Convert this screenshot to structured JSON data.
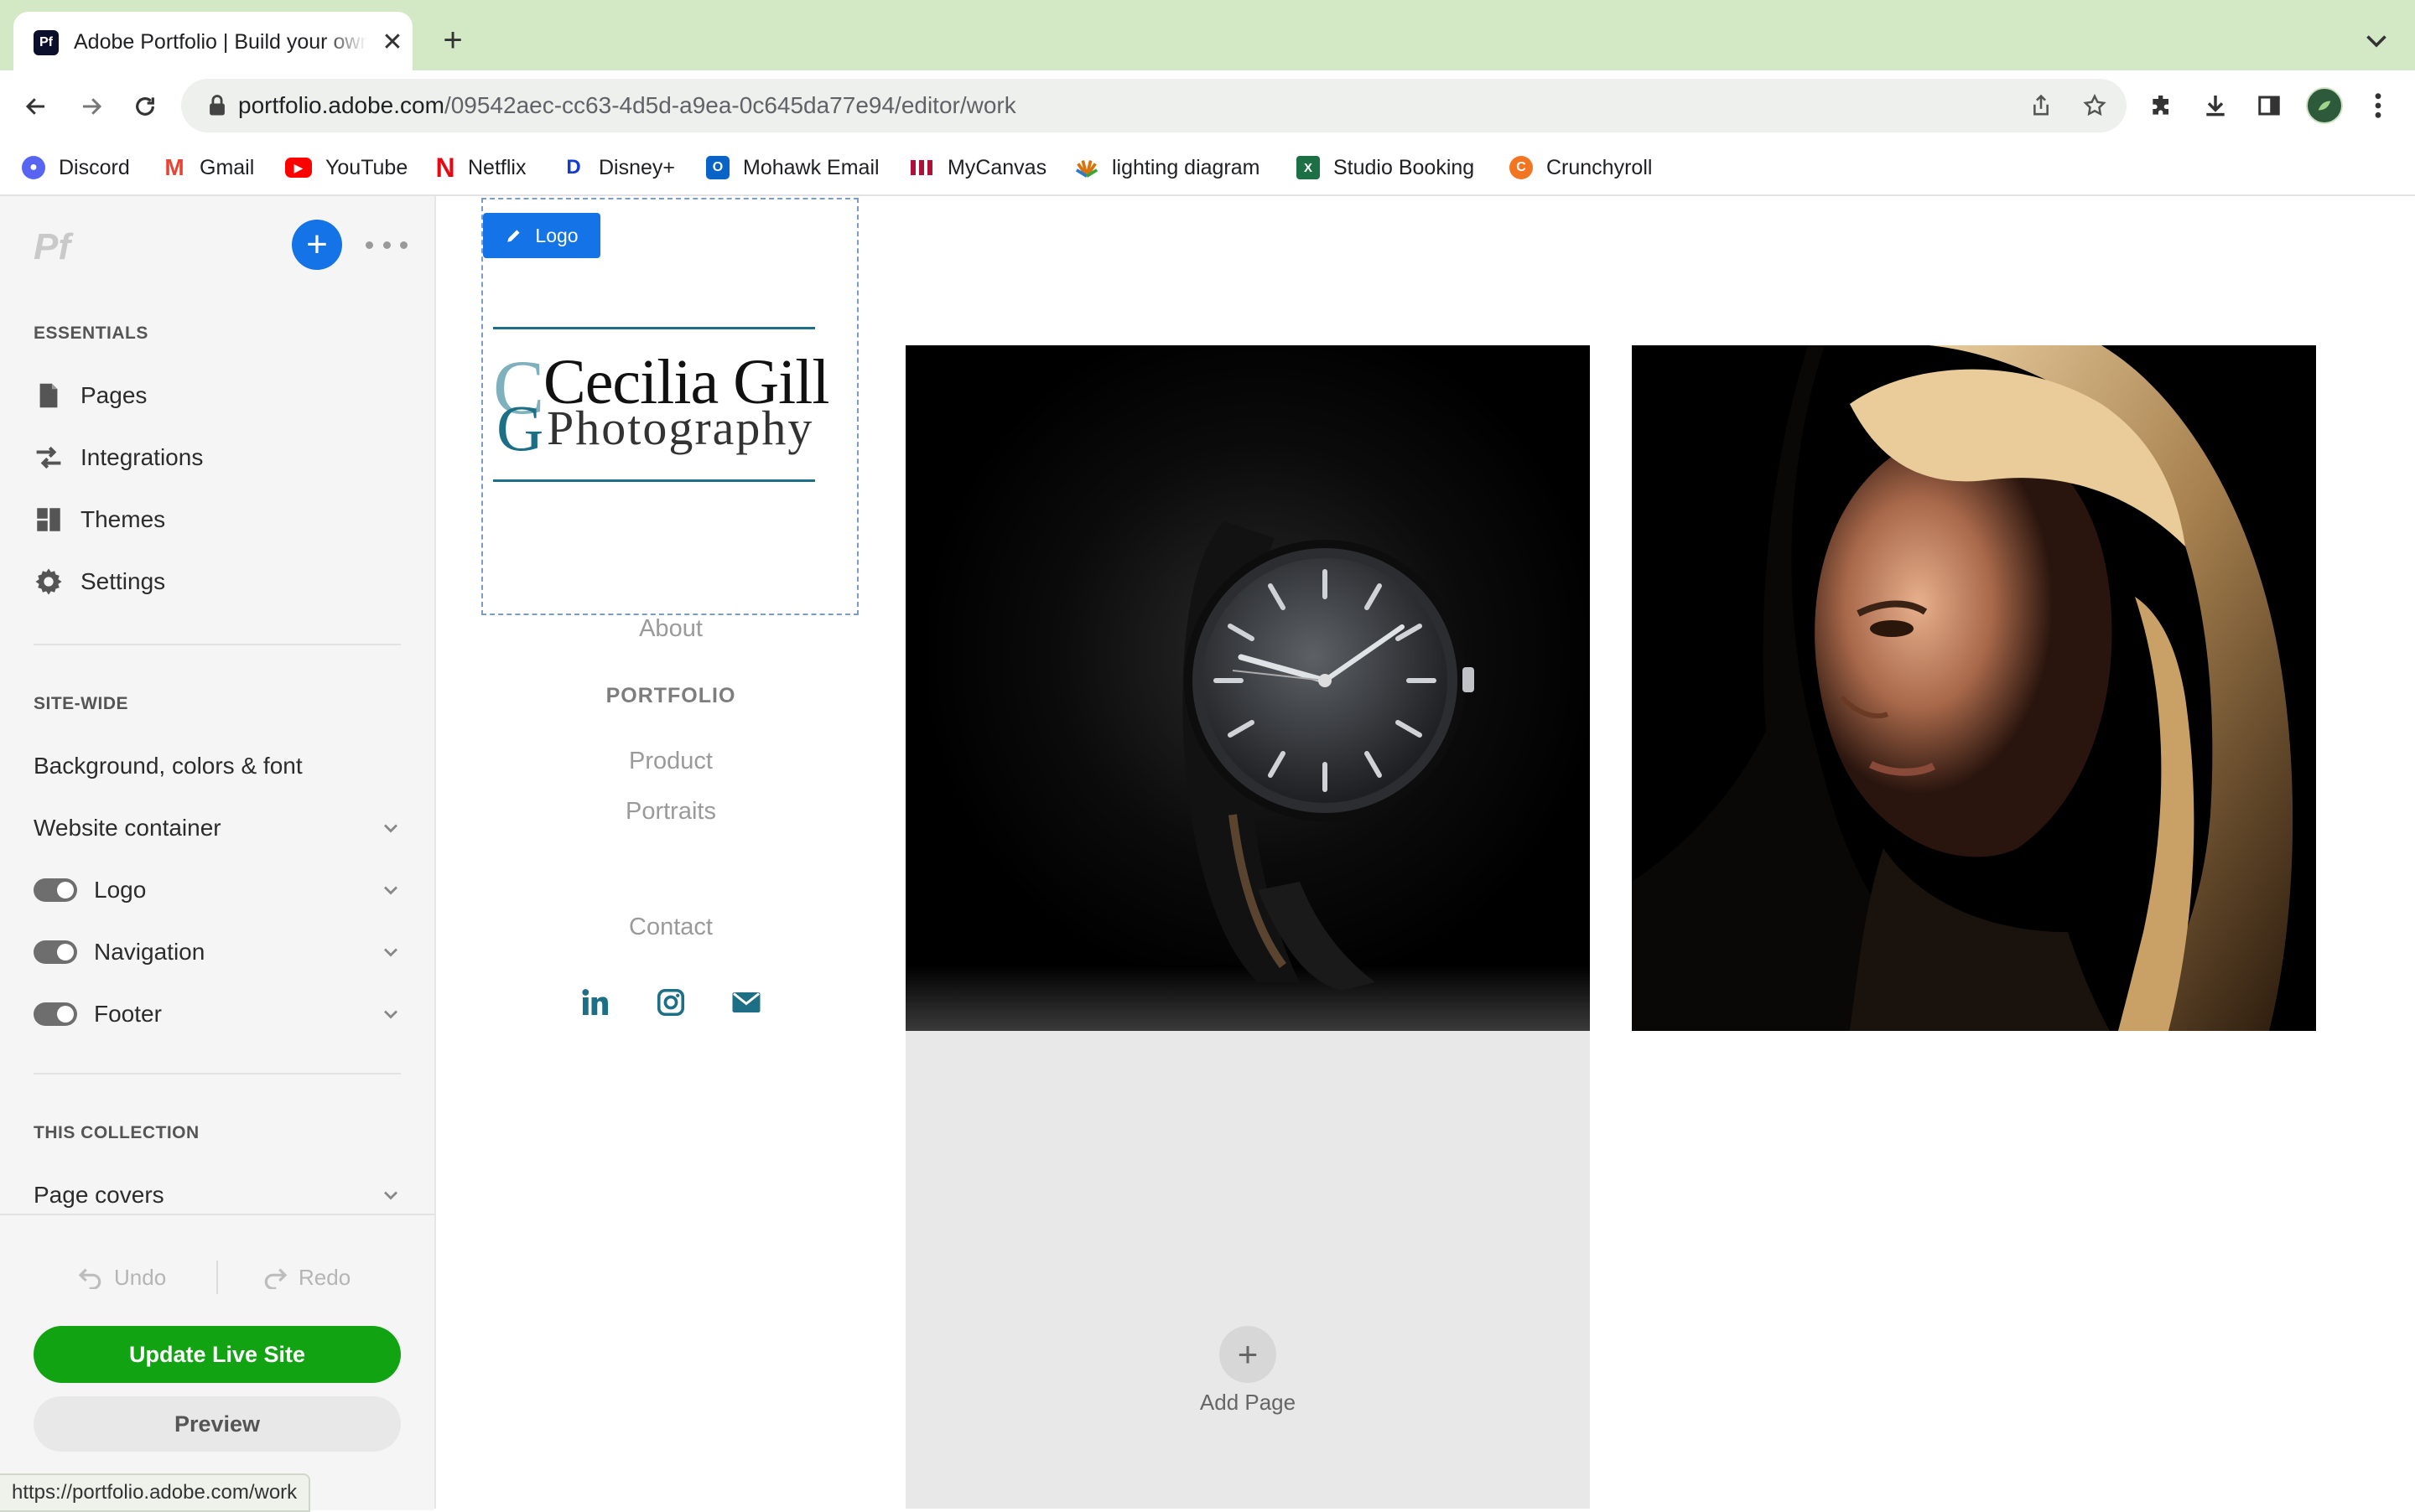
{
  "browser": {
    "tab_title": "Adobe Portfolio | Build your own personal website",
    "tab_favicon": "Pf",
    "url_host": "portfolio.adobe.com",
    "url_path": "/09542aec-cc63-4d5d-a9ea-0c645da77e94/editor/work",
    "bookmarks": [
      {
        "label": "Discord",
        "icon": "discord-icon",
        "color": "#5865f2"
      },
      {
        "label": "Gmail",
        "icon": "gmail-icon",
        "color": "#ea4335"
      },
      {
        "label": "YouTube",
        "icon": "youtube-icon",
        "color": "#ff0000"
      },
      {
        "label": "Netflix",
        "icon": "netflix-icon",
        "color": "#e50914"
      },
      {
        "label": "Disney+",
        "icon": "disney-icon",
        "color": "#113ccf"
      },
      {
        "label": "Mohawk Email",
        "icon": "outlook-icon",
        "color": "#0a64c8"
      },
      {
        "label": "MyCanvas",
        "icon": "canvas-icon",
        "color": "#b0113a"
      },
      {
        "label": "lighting diagram",
        "icon": "lighting-icon",
        "color": "#d9730d"
      },
      {
        "label": "Studio Booking",
        "icon": "excel-icon",
        "color": "#1d7044"
      },
      {
        "label": "Crunchyroll",
        "icon": "crunchyroll-icon",
        "color": "#f47521"
      }
    ],
    "status_url": "https://portfolio.adobe.com/work"
  },
  "sidebar": {
    "app_logo": "Pf",
    "essentials_label": "ESSENTIALS",
    "essentials": [
      {
        "label": "Pages",
        "icon": "page-icon"
      },
      {
        "label": "Integrations",
        "icon": "integrations-icon"
      },
      {
        "label": "Themes",
        "icon": "themes-icon"
      },
      {
        "label": "Settings",
        "icon": "gear-icon"
      }
    ],
    "sitewide_label": "SITE-WIDE",
    "background_label": "Background, colors & font",
    "website_container_label": "Website container",
    "logo_label": "Logo",
    "navigation_label": "Navigation",
    "footer_label": "Footer",
    "collection_label": "THIS COLLECTION",
    "page_covers_label": "Page covers",
    "undo_label": "Undo",
    "redo_label": "Redo",
    "update_label": "Update Live Site",
    "preview_label": "Preview"
  },
  "canvas": {
    "logo_tag": "Logo",
    "logo_mono": "C",
    "logo_mono2": "G",
    "logo_name": "Cecilia Gill",
    "logo_sub": "Photography",
    "nav": {
      "about": "About",
      "portfolio": "PORTFOLIO",
      "product": "Product",
      "portraits": "Portraits",
      "contact": "Contact"
    },
    "social_colors": {
      "linkedin": "#1d6f86",
      "instagram": "#1d6f86",
      "email": "#1d6f86"
    },
    "add_page_label": "Add Page"
  },
  "colors": {
    "accent_blue": "#1473e6",
    "update_green": "#12a312",
    "tabbar_green": "#d3e9c6"
  }
}
